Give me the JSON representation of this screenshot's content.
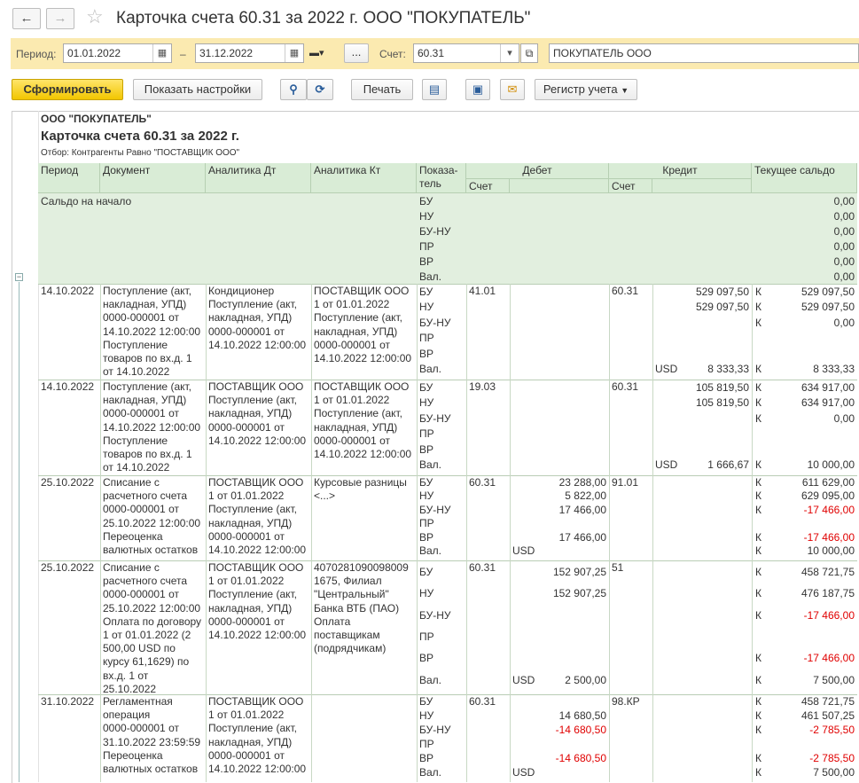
{
  "window": {
    "title": "Карточка счета 60.31 за 2022 г. ООО \"ПОКУПАТЕЛЬ\""
  },
  "params": {
    "period_label": "Период:",
    "date_from": "01.01.2022",
    "dash": "–",
    "date_to": "31.12.2022",
    "ellipsis": "...",
    "account_label": "Счет:",
    "account": "60.31",
    "org": "ПОКУПАТЕЛЬ ООО"
  },
  "toolbar": {
    "generate": "Сформировать",
    "show_settings": "Показать настройки",
    "print": "Печать",
    "register": "Регистр учета"
  },
  "report": {
    "org": "ООО \"ПОКУПАТЕЛЬ\"",
    "title": "Карточка счета 60.31 за 2022 г.",
    "filter": "Отбор: Контрагенты Равно \"ПОСТАВЩИК ООО\"",
    "headers": {
      "period": "Период",
      "document": "Документ",
      "an_dt": "Аналитика Дт",
      "an_kt": "Аналитика Кт",
      "indicator": "Показа-\nтель",
      "debit": "Дебет",
      "credit": "Кредит",
      "balance": "Текущее сальдо",
      "debit_account": "Счет",
      "credit_account": "Счет"
    },
    "opening": {
      "label": "Сальдо на начало",
      "indicators": [
        "БУ",
        "НУ",
        "БУ-НУ",
        "ПР",
        "ВР",
        "Вал."
      ],
      "values": [
        "0,00",
        "0,00",
        "0,00",
        "0,00",
        "0,00",
        "0,00"
      ]
    },
    "rows": [
      {
        "period": "14.10.2022",
        "document": [
          "Поступление (акт,",
          "накладная, УПД)",
          "0000-000001 от",
          "14.10.2022 12:00:00",
          "Поступление",
          "товаров по вх.д. 1",
          "от 14.10.2022"
        ],
        "an_dt": [
          "Кондиционер",
          "Поступление (акт,",
          "накладная, УПД)",
          "0000-000001 от",
          "14.10.2022 12:00:00"
        ],
        "an_kt": [
          "ПОСТАВЩИК ООО",
          "1 от 01.01.2022",
          "Поступление (акт,",
          "накладная, УПД)",
          "0000-000001 от",
          "14.10.2022 12:00:00"
        ],
        "indicators": [
          "БУ",
          "НУ",
          "БУ-НУ",
          "ПР",
          "ВР",
          "Вал."
        ],
        "debit_account": "41.01",
        "debit_cur": [
          "",
          "",
          "",
          "",
          "",
          ""
        ],
        "debit_sum": [
          "",
          "",
          "",
          "",
          "",
          ""
        ],
        "credit_account": "60.31",
        "credit_cur": [
          "",
          "",
          "",
          "",
          "",
          "USD"
        ],
        "credit_sum": [
          "529 097,50",
          "529 097,50",
          "",
          "",
          "",
          "8 333,33"
        ],
        "bal_side": [
          "К",
          "К",
          "К",
          "",
          "",
          "К"
        ],
        "balance": [
          "529 097,50",
          "529 097,50",
          "0,00",
          "",
          "",
          "8 333,33"
        ]
      },
      {
        "period": "14.10.2022",
        "document": [
          "Поступление (акт,",
          "накладная, УПД)",
          "0000-000001 от",
          "14.10.2022 12:00:00",
          "Поступление",
          "товаров по вх.д. 1",
          "от 14.10.2022"
        ],
        "an_dt": [
          "ПОСТАВЩИК ООО",
          "Поступление (акт,",
          "накладная, УПД)",
          "0000-000001 от",
          "14.10.2022 12:00:00"
        ],
        "an_kt": [
          "ПОСТАВЩИК ООО",
          "1 от 01.01.2022",
          "Поступление (акт,",
          "накладная, УПД)",
          "0000-000001 от",
          "14.10.2022 12:00:00"
        ],
        "indicators": [
          "БУ",
          "НУ",
          "БУ-НУ",
          "ПР",
          "ВР",
          "Вал."
        ],
        "debit_account": "19.03",
        "debit_cur": [
          "",
          "",
          "",
          "",
          "",
          ""
        ],
        "debit_sum": [
          "",
          "",
          "",
          "",
          "",
          ""
        ],
        "credit_account": "60.31",
        "credit_cur": [
          "",
          "",
          "",
          "",
          "",
          "USD"
        ],
        "credit_sum": [
          "105 819,50",
          "105 819,50",
          "",
          "",
          "",
          "1 666,67"
        ],
        "bal_side": [
          "К",
          "К",
          "К",
          "",
          "",
          "К"
        ],
        "balance": [
          "634 917,00",
          "634 917,00",
          "0,00",
          "",
          "",
          "10 000,00"
        ]
      },
      {
        "period": "25.10.2022",
        "document": [
          "Списание с",
          "расчетного счета",
          "0000-000001 от",
          "25.10.2022 12:00:00",
          "Переоценка",
          "валютных остатков"
        ],
        "an_dt": [
          "ПОСТАВЩИК ООО",
          "1 от 01.01.2022",
          "Поступление (акт,",
          "накладная, УПД)",
          "0000-000001 от",
          "14.10.2022 12:00:00"
        ],
        "an_kt": [
          "Курсовые разницы",
          "<...>"
        ],
        "indicators": [
          "БУ",
          "НУ",
          "БУ-НУ",
          "ПР",
          "ВР",
          "Вал."
        ],
        "debit_account": "60.31",
        "debit_cur": [
          "",
          "",
          "",
          "",
          "",
          "USD"
        ],
        "debit_sum": [
          "23 288,00",
          "5 822,00",
          "17 466,00",
          "",
          "17 466,00",
          ""
        ],
        "credit_account": "91.01",
        "credit_cur": [
          "",
          "",
          "",
          "",
          "",
          ""
        ],
        "credit_sum": [
          "",
          "",
          "",
          "",
          "",
          ""
        ],
        "bal_side": [
          "К",
          "К",
          "К",
          "",
          "К",
          "К"
        ],
        "balance": [
          "611 629,00",
          "629 095,00",
          "-17 466,00",
          "",
          "-17 466,00",
          "10 000,00"
        ]
      },
      {
        "period": "25.10.2022",
        "document": [
          "Списание с",
          "расчетного счета",
          "0000-000001 от",
          "25.10.2022 12:00:00",
          "Оплата по договору",
          "1 от 01.01.2022 (2",
          "500,00 USD по",
          "курсу 61,1629) по",
          "вх.д. 1 от",
          "25.10.2022"
        ],
        "an_dt": [
          "ПОСТАВЩИК ООО",
          "1 от 01.01.2022",
          "Поступление (акт,",
          "накладная, УПД)",
          "0000-000001 от",
          "14.10.2022 12:00:00"
        ],
        "an_kt": [
          "4070281090098009",
          "1675, Филиал",
          "\"Центральный\"",
          "Банка ВТБ (ПАО)",
          "Оплата",
          "поставщикам",
          "(подрядчикам)"
        ],
        "indicators": [
          "БУ",
          "НУ",
          "БУ-НУ",
          "ПР",
          "ВР",
          "Вал."
        ],
        "debit_account": "60.31",
        "debit_cur": [
          "",
          "",
          "",
          "",
          "",
          "USD"
        ],
        "debit_sum": [
          "152 907,25",
          "152 907,25",
          "",
          "",
          "",
          "2 500,00"
        ],
        "credit_account": "51",
        "credit_cur": [
          "",
          "",
          "",
          "",
          "",
          ""
        ],
        "credit_sum": [
          "",
          "",
          "",
          "",
          "",
          ""
        ],
        "bal_side": [
          "К",
          "К",
          "К",
          "",
          "К",
          "К"
        ],
        "balance": [
          "458 721,75",
          "476 187,75",
          "-17 466,00",
          "",
          "-17 466,00",
          "7 500,00"
        ]
      },
      {
        "period": "31.10.2022",
        "document": [
          "Регламентная",
          "операция",
          "0000-000001 от",
          "31.10.2022 23:59:59",
          "Переоценка",
          "валютных остатков"
        ],
        "an_dt": [
          "ПОСТАВЩИК ООО",
          "1 от 01.01.2022",
          "Поступление (акт,",
          "накладная, УПД)",
          "0000-000001 от",
          "14.10.2022 12:00:00"
        ],
        "an_kt": [],
        "indicators": [
          "БУ",
          "НУ",
          "БУ-НУ",
          "ПР",
          "ВР",
          "Вал."
        ],
        "debit_account": "60.31",
        "debit_cur": [
          "",
          "",
          "",
          "",
          "",
          "USD"
        ],
        "debit_sum": [
          "",
          "14 680,50",
          "-14 680,50",
          "",
          "-14 680,50",
          ""
        ],
        "credit_account": "98.КР",
        "credit_cur": [
          "",
          "",
          "",
          "",
          "",
          ""
        ],
        "credit_sum": [
          "",
          "",
          "",
          "",
          "",
          ""
        ],
        "bal_side": [
          "К",
          "К",
          "К",
          "",
          "К",
          "К"
        ],
        "balance": [
          "458 721,75",
          "461 507,25",
          "-2 785,50",
          "",
          "-2 785,50",
          "7 500,00"
        ]
      }
    ]
  }
}
